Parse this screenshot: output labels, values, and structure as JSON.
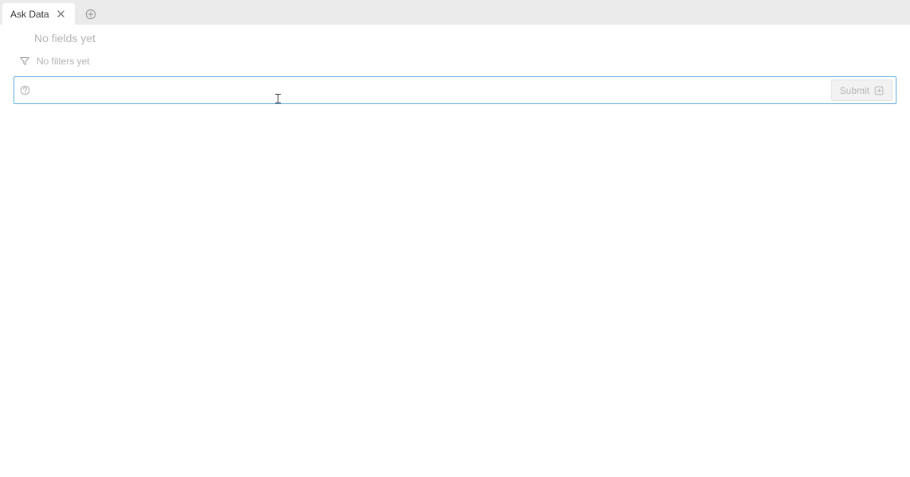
{
  "tabs": {
    "active_label": "Ask Data"
  },
  "fields": {
    "empty_text": "No fields yet"
  },
  "filters": {
    "empty_text": "No filters yet"
  },
  "query": {
    "value": "",
    "placeholder": "",
    "submit_label": "Submit"
  }
}
